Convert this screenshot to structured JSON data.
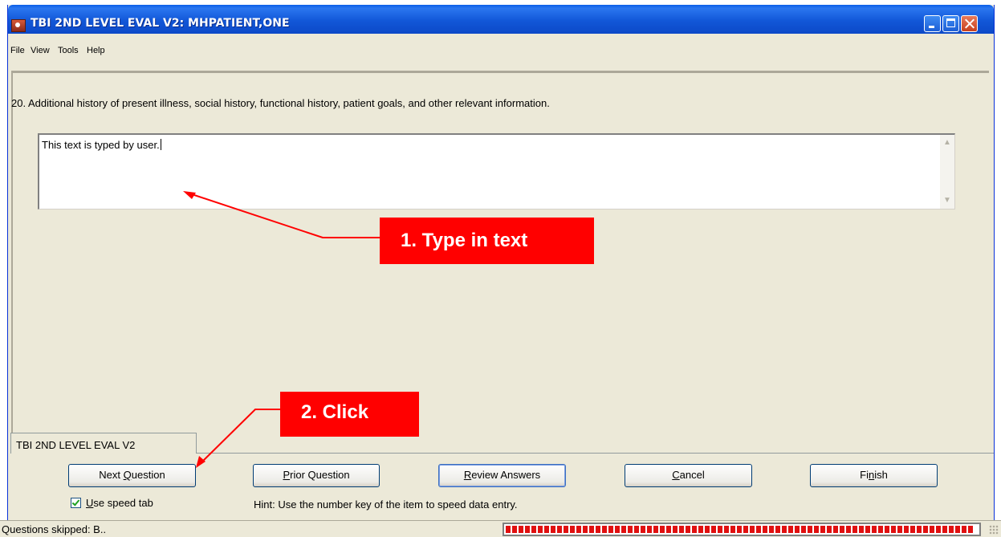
{
  "window": {
    "title": "TBI 2ND LEVEL EVAL V2: MHPATIENT,ONE"
  },
  "menu": [
    "File",
    "View",
    "Tools",
    "Help"
  ],
  "question": {
    "text": "20. Additional history of present illness, social history, functional history, patient goals, and other relevant information.",
    "answer": "This text is typed by user."
  },
  "annotations": {
    "step1": "1. Type in text",
    "step2": "2. Click",
    "color": "#ff0000"
  },
  "tab": {
    "label": "TBI 2ND LEVEL EVAL V2"
  },
  "buttons": {
    "next": {
      "pre": "Next ",
      "key": "Q",
      "post": "uestion"
    },
    "prior": {
      "pre": "",
      "key": "P",
      "post": "rior Question"
    },
    "review": {
      "pre": "",
      "key": "R",
      "post": "eview Answers"
    },
    "cancel": {
      "pre": "",
      "key": "C",
      "post": "ancel"
    },
    "finish": {
      "pre": "Fi",
      "key": "n",
      "post": "ish"
    }
  },
  "options": {
    "speed_tab": {
      "key": "U",
      "rest": "se speed tab",
      "checked": true
    }
  },
  "hint": "Hint: Use the number key of the item to speed data entry.",
  "status": {
    "text": "Questions skipped: B..",
    "progress": 0.99
  },
  "icons": [
    "app-icon",
    "minimize-icon",
    "maximize-icon",
    "close-icon",
    "scroll-up-icon",
    "scroll-down-icon",
    "checkbox-check-icon",
    "resize-grip-icon"
  ]
}
